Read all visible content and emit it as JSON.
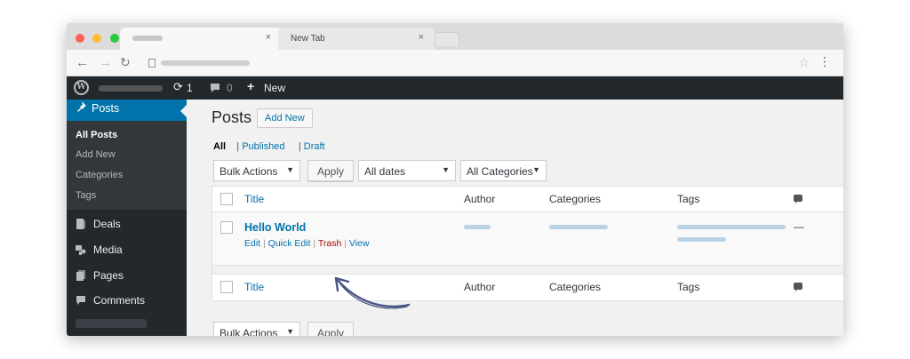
{
  "browser": {
    "tabs": [
      {
        "label": "",
        "close": "×"
      },
      {
        "label": "New Tab",
        "close": "×"
      }
    ],
    "colors": {
      "red": "#ff5f57",
      "yellow": "#febc2e",
      "green": "#28c840"
    }
  },
  "adminbar": {
    "updates_count": "1",
    "comments_count": "0",
    "new_label": "New"
  },
  "sidebar": {
    "posts_label": "Posts",
    "submenu": [
      "All Posts",
      "Add New",
      "Categories",
      "Tags"
    ],
    "items": [
      "Deals",
      "Media",
      "Pages",
      "Comments"
    ]
  },
  "content": {
    "title": "Posts",
    "add_new": "Add New",
    "filters": {
      "all": "All",
      "published": "Published",
      "draft": "Draft",
      "sep": "|"
    },
    "bulk_actions": "Bulk Actions",
    "apply": "Apply",
    "dates": "All dates",
    "categories_filter": "All Categories",
    "columns": {
      "title": "Title",
      "author": "Author",
      "categories": "Categories",
      "tags": "Tags"
    },
    "row": {
      "title": "Hello World",
      "edit": "Edit",
      "quick_edit": "Quick Edit",
      "trash": "Trash",
      "view": "View",
      "comments": "—"
    }
  }
}
